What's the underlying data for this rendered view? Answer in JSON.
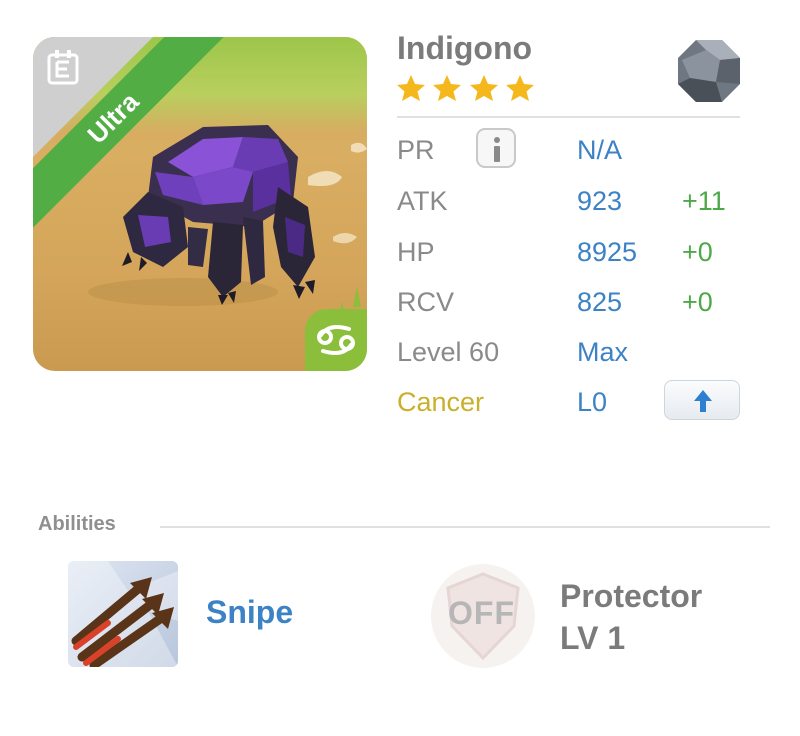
{
  "monster": {
    "name": "Indigono",
    "rarity": "Ultra",
    "stars": 4,
    "element_icon": "stone-gem-icon",
    "zodiac_icon": "cancer-zodiac-icon"
  },
  "stats": {
    "pr": {
      "label": "PR",
      "value": "N/A"
    },
    "atk": {
      "label": "ATK",
      "value": "923",
      "bonus": "+11"
    },
    "hp": {
      "label": "HP",
      "value": "8925",
      "bonus": "+0"
    },
    "rcv": {
      "label": "RCV",
      "value": "825",
      "bonus": "+0"
    },
    "level": {
      "label": "Level 60",
      "value": "Max"
    },
    "sign": {
      "label": "Cancer",
      "value": "L0"
    }
  },
  "abilities": {
    "header": "Abilities",
    "primary": {
      "name": "Snipe",
      "icon": "arrows-icon"
    },
    "secondary": {
      "status": "OFF",
      "name": "Protector",
      "level": "LV 1",
      "icon": "shield-icon"
    }
  },
  "colors": {
    "accent_blue": "#3d82c4",
    "bonus_green": "#4ea84a",
    "ultra_green": "#52ad44",
    "cancer_gold": "#c9b02a",
    "star_gold": "#f5b81c"
  }
}
